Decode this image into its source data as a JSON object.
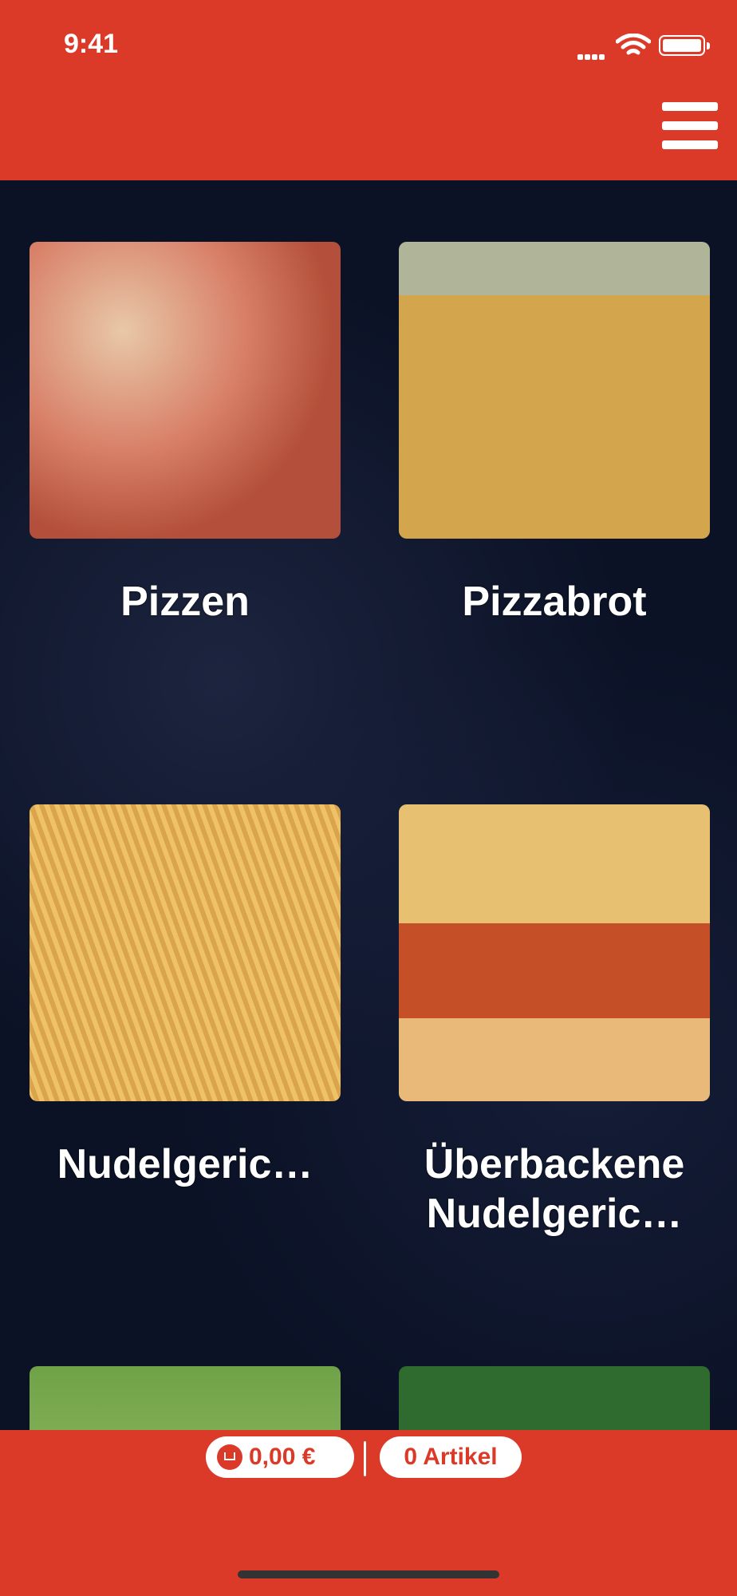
{
  "status": {
    "time": "9:41"
  },
  "categories": [
    {
      "label": "Pizzen"
    },
    {
      "label": "Pizzabrot"
    },
    {
      "label": "Nudelgeric…"
    },
    {
      "label": "Überbackene Nudelgeric…"
    },
    {
      "label": ""
    },
    {
      "label": ""
    }
  ],
  "cart": {
    "price": "0,00 €",
    "items": "0 Artikel"
  },
  "colors": {
    "primary": "#dc3a29",
    "background": "#0b1226"
  }
}
